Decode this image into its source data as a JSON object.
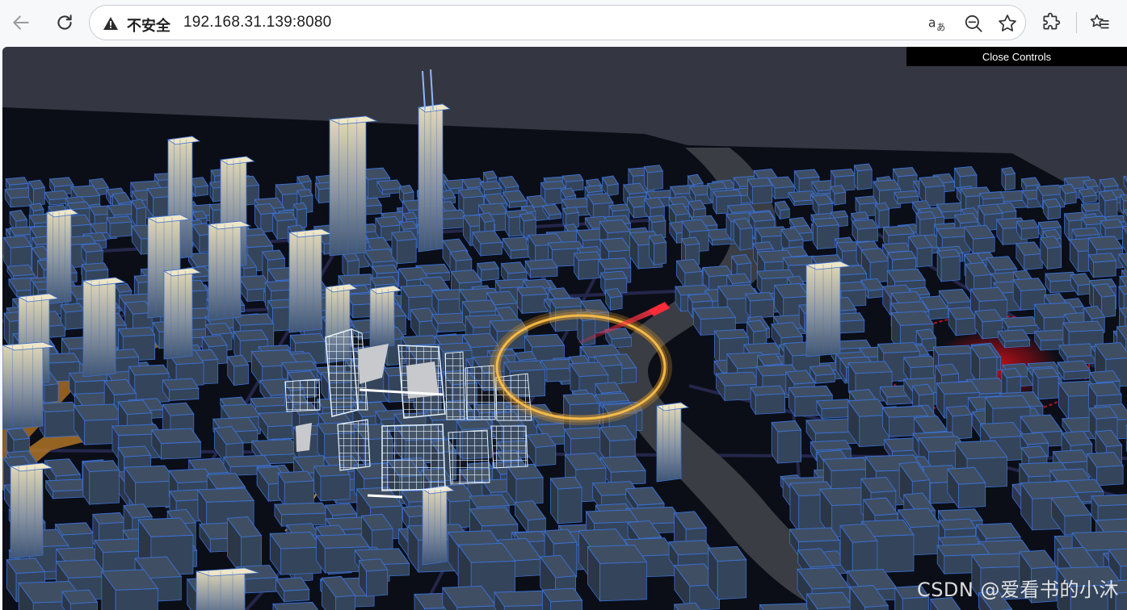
{
  "browser": {
    "security_label": "不安全",
    "url": "192.168.31.139:8080",
    "icons": [
      "back-arrow-icon",
      "reload-icon",
      "warning-triangle-icon",
      "read-aloud-icon",
      "zoom-out-icon",
      "favorite-star-icon",
      "extensions-icon",
      "favorites-list-icon"
    ]
  },
  "scene": {
    "controls_button": "Close Controls",
    "watermark": "CSDN @爱看书的小沐",
    "colors": {
      "background": "#343741",
      "ground": "#0b0e17",
      "building_top": "#3f4e62",
      "building_edge": "#3a6fd0",
      "tower_gradient_top": "#e2d7b4",
      "tower_gradient_bottom": "#43587a",
      "river": "#3a3d43",
      "road": "#25264a",
      "orange_road": "#b97b26",
      "halo_ring": "#f0a52a",
      "red_zone": "#d01018",
      "wireframe": "#dff0ff"
    }
  }
}
